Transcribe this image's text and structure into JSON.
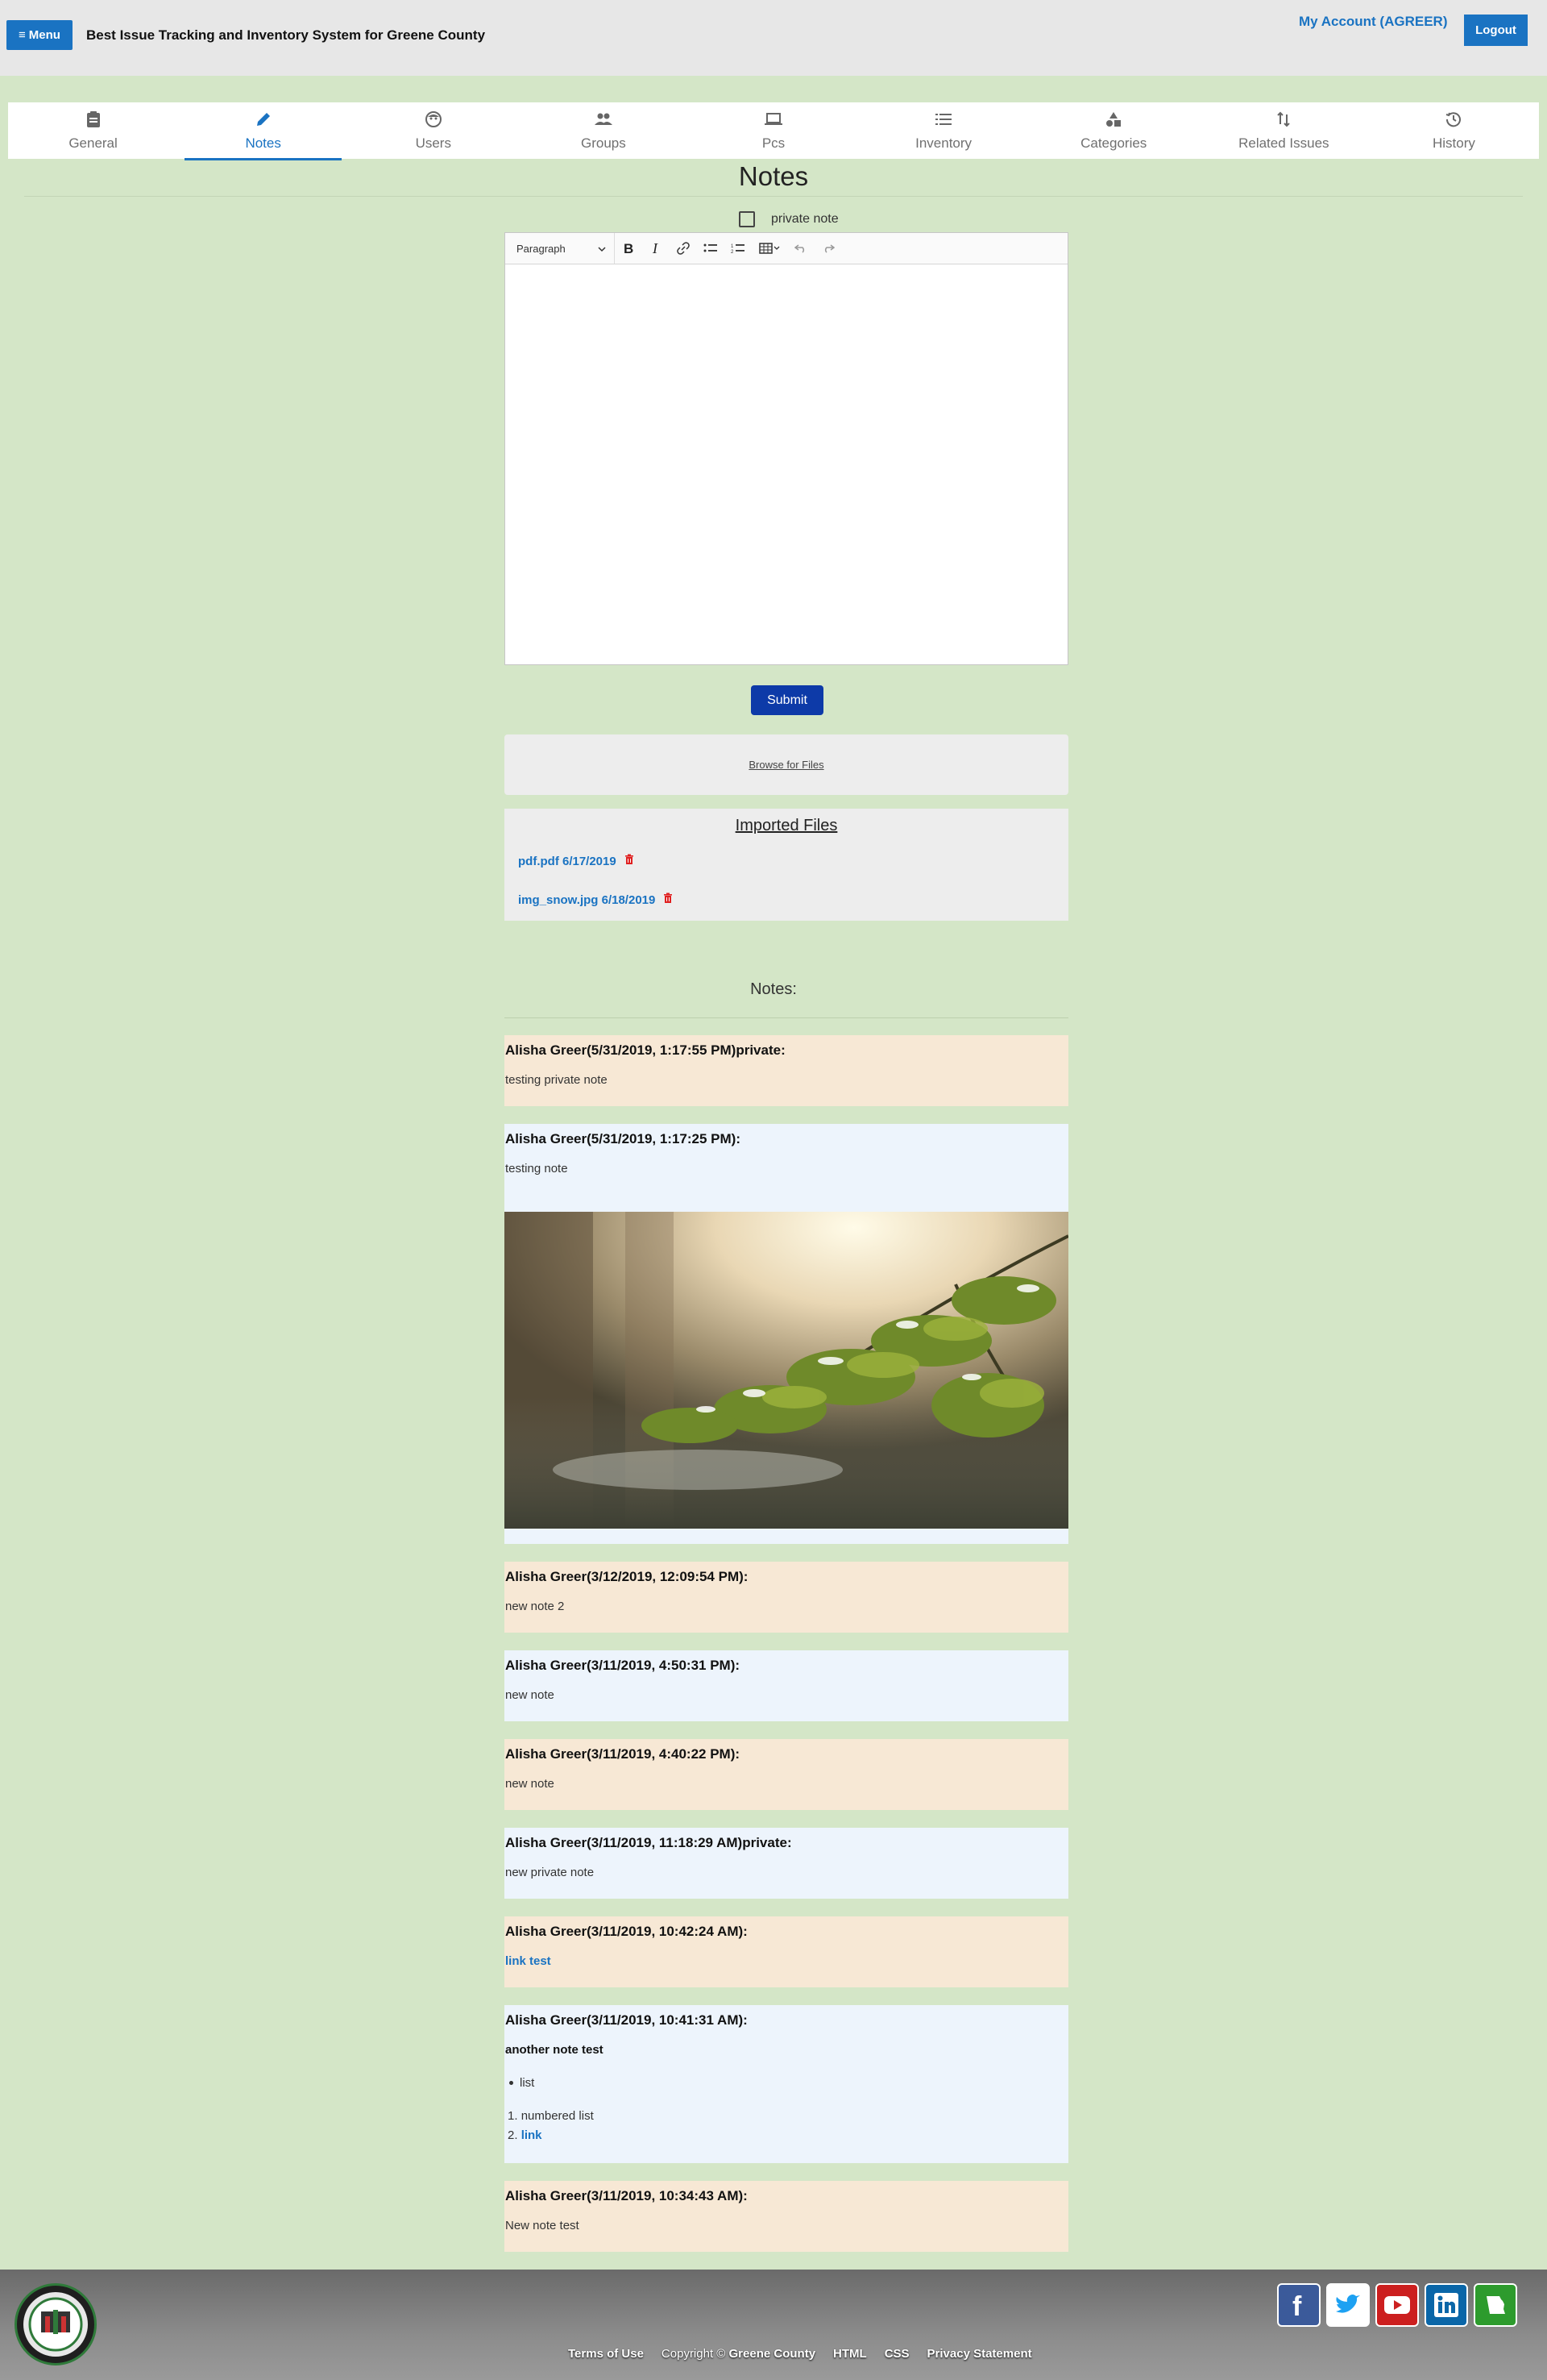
{
  "header": {
    "menu_label": "Menu",
    "title": "Best Issue Tracking and Inventory System for Greene County",
    "account_label": "My Account (AGREER)",
    "logout_label": "Logout"
  },
  "tabs": [
    {
      "label": "General",
      "icon": "clipboard-icon",
      "active": false
    },
    {
      "label": "Notes",
      "icon": "pencil-icon",
      "active": true
    },
    {
      "label": "Users",
      "icon": "face-icon",
      "active": false
    },
    {
      "label": "Groups",
      "icon": "group-icon",
      "active": false
    },
    {
      "label": "Pcs",
      "icon": "laptop-icon",
      "active": false
    },
    {
      "label": "Inventory",
      "icon": "list-icon",
      "active": false
    },
    {
      "label": "Categories",
      "icon": "shapes-icon",
      "active": false
    },
    {
      "label": "Related Issues",
      "icon": "sort-arrows-icon",
      "active": false
    },
    {
      "label": "History",
      "icon": "history-icon",
      "active": false
    }
  ],
  "page_title": "Notes",
  "private_note_label": "private note",
  "editor": {
    "paragraph_label": "Paragraph",
    "submit_label": "Submit"
  },
  "browse_label": "Browse for Files",
  "imported": {
    "title": "Imported Files",
    "files": [
      {
        "label": "pdf.pdf 6/17/2019"
      },
      {
        "label": "img_snow.jpg 6/18/2019"
      }
    ]
  },
  "notes_label": "Notes:",
  "notes": [
    {
      "head": "Alisha Greer(5/31/2019, 1:17:55 PM)private:",
      "body": "testing private note"
    },
    {
      "head": "Alisha Greer(5/31/2019, 1:17:25 PM):",
      "body": "testing note"
    },
    {
      "head": "Alisha Greer(3/12/2019, 12:09:54 PM):",
      "body": "new note 2"
    },
    {
      "head": "Alisha Greer(3/11/2019, 4:50:31 PM):",
      "body": "new note"
    },
    {
      "head": "Alisha Greer(3/11/2019, 4:40:22 PM):",
      "body": "new note"
    },
    {
      "head": "Alisha Greer(3/11/2019, 11:18:29 AM)private:",
      "body": "new private note"
    },
    {
      "head": "Alisha Greer(3/11/2019, 10:42:24 AM):",
      "body": "link test"
    },
    {
      "head": "Alisha Greer(3/11/2019, 10:41:31 AM):",
      "body": "another note test",
      "bullet": "list",
      "numbered": [
        "numbered list",
        "link"
      ]
    },
    {
      "head": "Alisha Greer(3/11/2019, 10:34:43 AM):",
      "body": "New note test"
    }
  ],
  "footer": {
    "terms": "Terms of Use",
    "copyright": "Copyright ©",
    "copyright_owner": "Greene County",
    "html": "HTML",
    "css": "CSS",
    "privacy": "Privacy Statement",
    "social": [
      "facebook-icon",
      "twitter-icon",
      "youtube-icon",
      "linkedin-icon",
      "missouri-icon"
    ]
  },
  "colors": {
    "page_bg": "#d4e6c7",
    "accent": "#1a73c2",
    "submit": "#0d3aa8",
    "note_peach": "#f7e8d5",
    "note_blue": "#edf4fc"
  }
}
